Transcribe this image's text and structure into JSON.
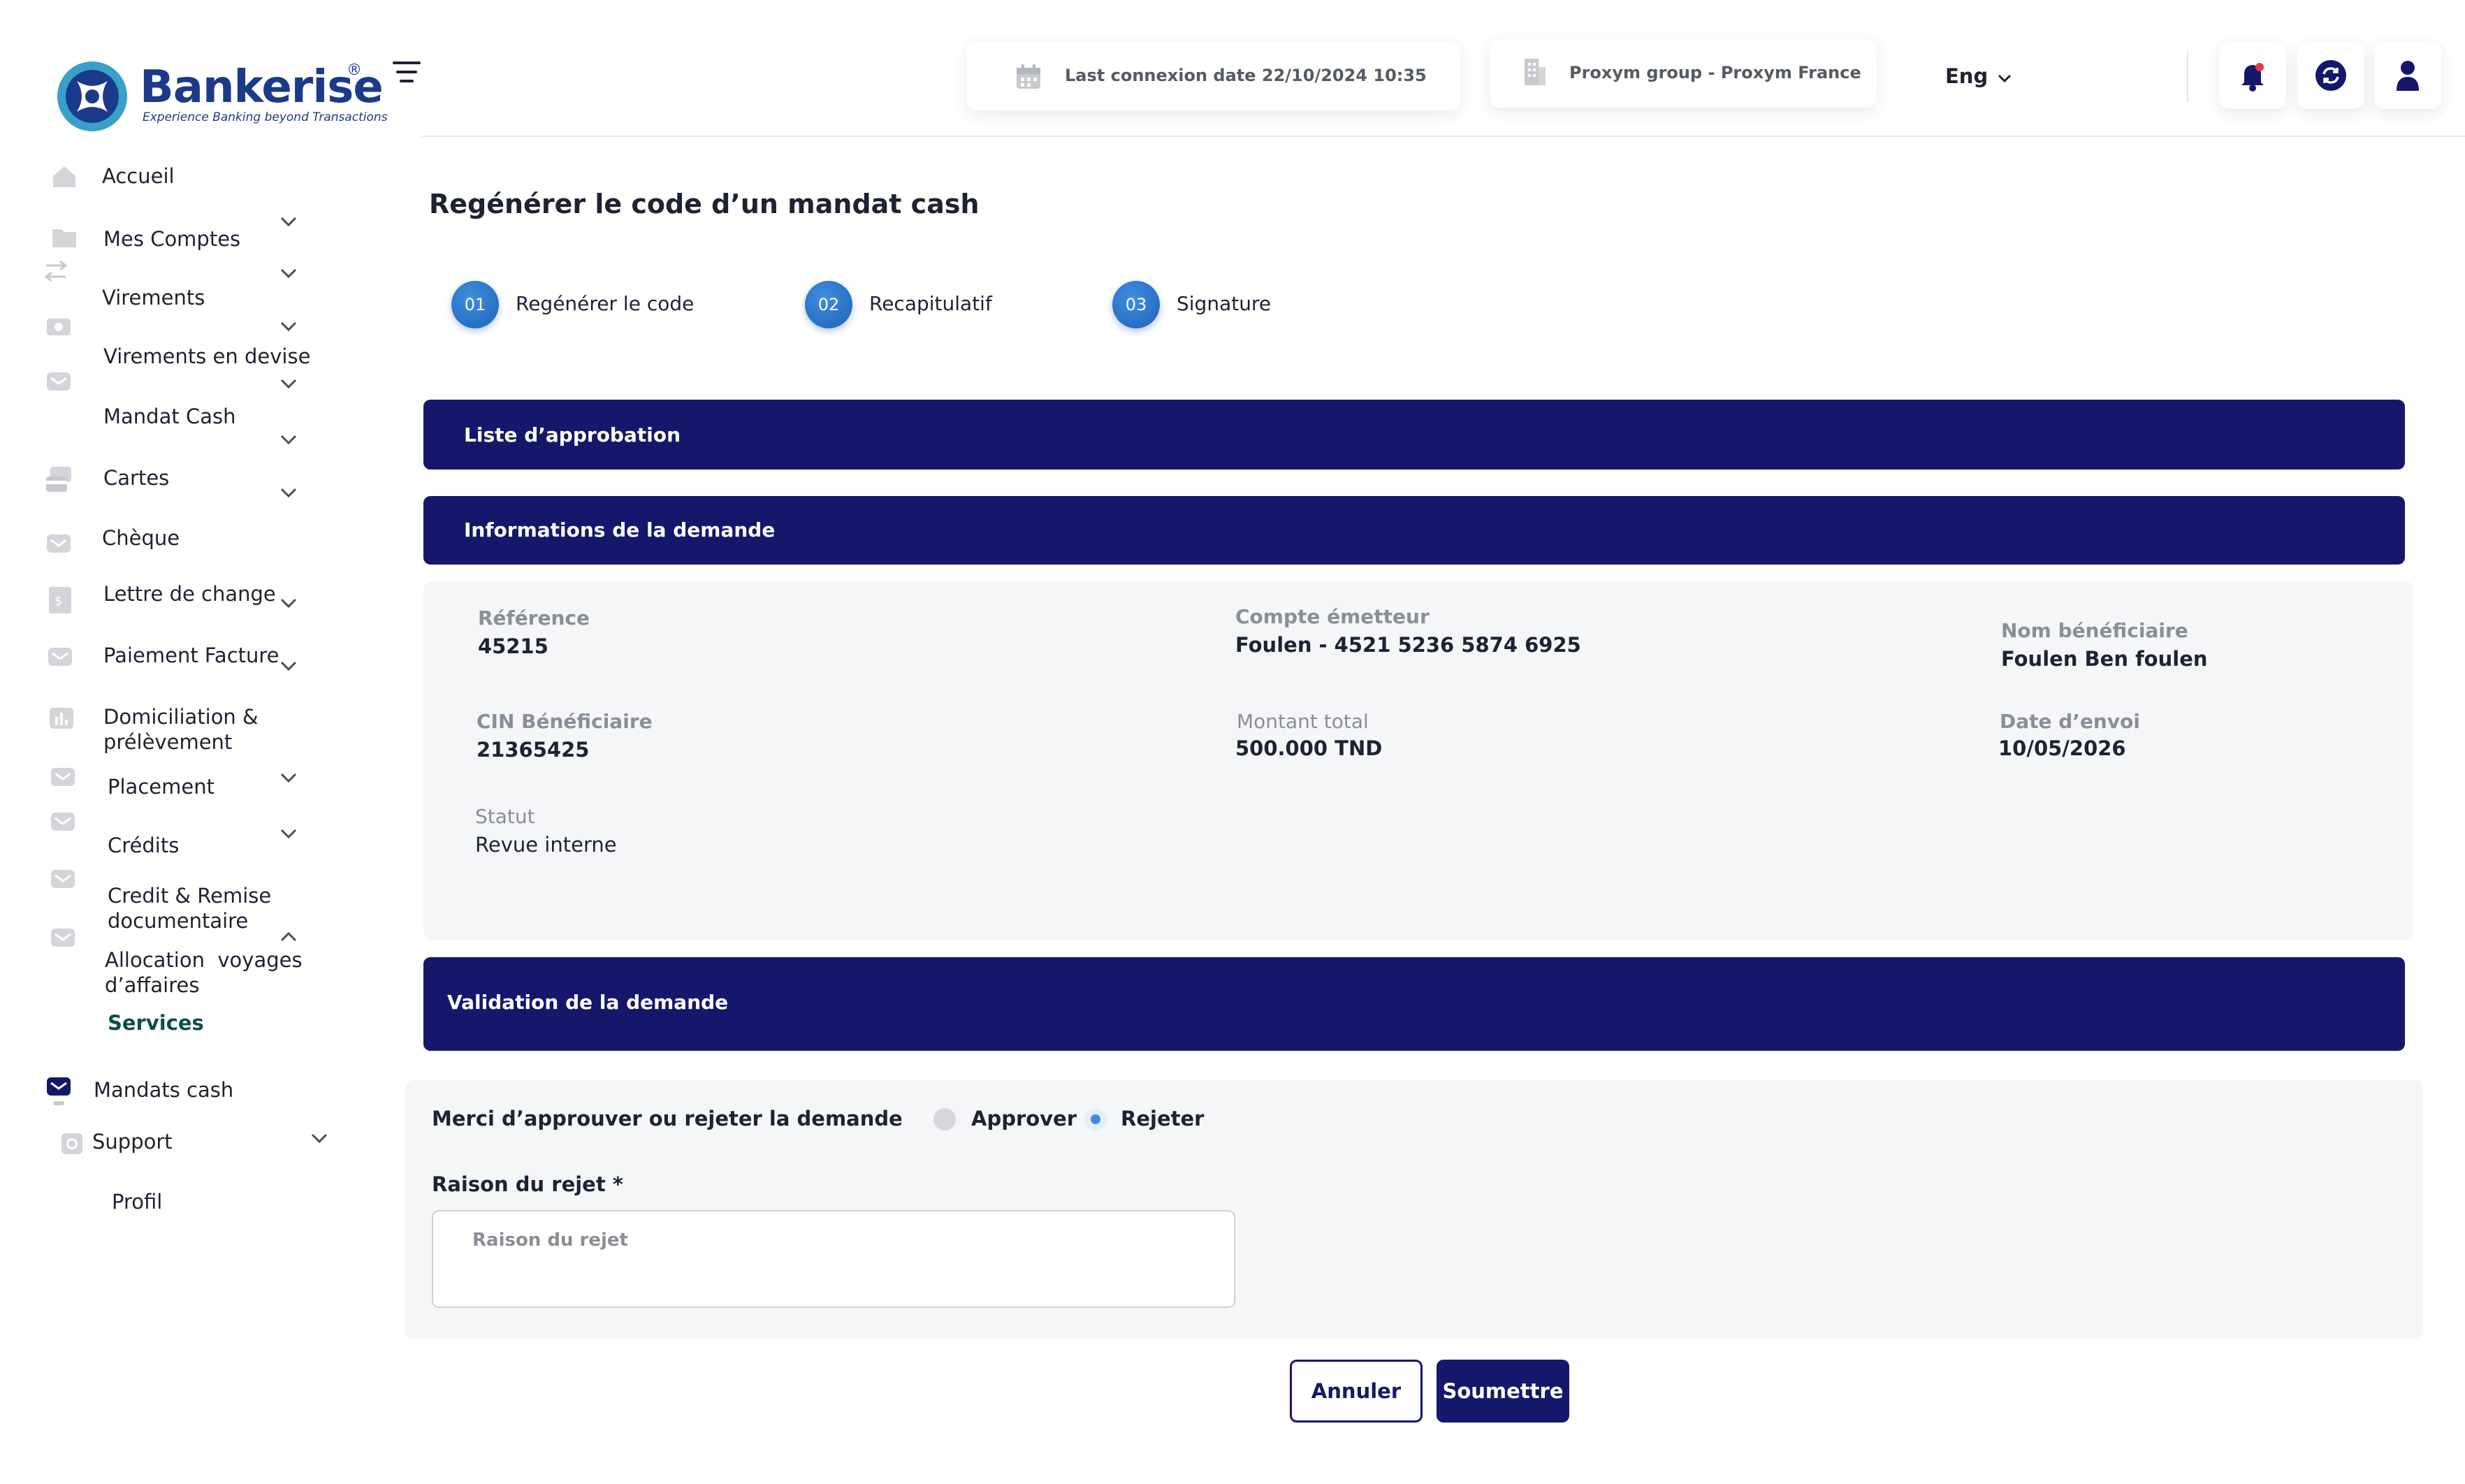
{
  "brand": {
    "name": "Bankerise",
    "registered": "®",
    "tagline": "Experience Banking beyond Transactions",
    "colors": {
      "navy": "#15186a",
      "blue": "#1f62b8",
      "teal": "#3aa0c8"
    }
  },
  "sidebar": {
    "items": [
      {
        "label": "Accueil",
        "icon": "home-icon"
      },
      {
        "label": "Mes Comptes",
        "icon": "folder-icon"
      },
      {
        "label": "Virements",
        "icon": "transfer-icon"
      },
      {
        "label": "Virements en devise",
        "icon": "currency-icon"
      },
      {
        "label": "Mandat Cash",
        "icon": "mail-icon"
      },
      {
        "label": "Cartes",
        "icon": "cards-icon"
      },
      {
        "label": "Chèque",
        "icon": "mail-icon"
      },
      {
        "label": "Lettre de change",
        "icon": "receipt-icon"
      },
      {
        "label": "Paiement Facture",
        "icon": "mail-icon"
      },
      {
        "label": "Domiciliation & prélèvement",
        "icon": "chart-icon"
      },
      {
        "label": "Placement",
        "icon": "mail-icon"
      },
      {
        "label": "Crédits",
        "icon": "mail-icon"
      },
      {
        "label": "Credit & Remise documentaire",
        "icon": "mail-icon"
      },
      {
        "label": "Allocation  voyages d’affaires",
        "icon": "mail-icon"
      },
      {
        "label": "Services"
      },
      {
        "label": "Mandats cash",
        "icon": "mail-icon"
      },
      {
        "label": "Support",
        "icon": "support-icon"
      },
      {
        "label": "Profil"
      }
    ]
  },
  "header": {
    "last_connexion": "Last connexion date 22/10/2024 10:35",
    "group": "Proxym group - Proxym France",
    "language": "Eng"
  },
  "page": {
    "title": "Regénérer le code d’un mandat cash",
    "steps": [
      {
        "num": "01",
        "label": "Regénérer le code"
      },
      {
        "num": "02",
        "label": "Recapitulatif"
      },
      {
        "num": "03",
        "label": "Signature"
      }
    ],
    "sections": {
      "approval_list": "Liste d’approbation",
      "request_info": "Informations de la demande",
      "validation": "Validation de la demande"
    },
    "fields": {
      "reference": {
        "label": "Référence",
        "value": "45215"
      },
      "compte_emetteur": {
        "label": "Compte émetteur",
        "value": "Foulen - 4521 5236 5874 6925"
      },
      "nom_beneficiaire": {
        "label": "Nom bénéficiaire",
        "value": "Foulen Ben foulen"
      },
      "cin_beneficiaire": {
        "label": "CIN Bénéficiaire",
        "value": "21365425"
      },
      "montant_total": {
        "label": "Montant total",
        "value": "500.000 TND"
      },
      "date_envoi": {
        "label": "Date d’envoi",
        "value": "10/05/2026"
      },
      "statut": {
        "label": "Statut",
        "value": "Revue interne"
      }
    },
    "validation": {
      "question": "Merci d’approuver ou rejeter la demande",
      "approve_label": "Approver",
      "reject_label": "Rejeter",
      "selected": "Rejeter",
      "reason_label": "Raison du rejet *",
      "reason_placeholder": "Raison du rejet",
      "reason_value": ""
    },
    "buttons": {
      "cancel": "Annuler",
      "submit": "Soumettre"
    }
  }
}
